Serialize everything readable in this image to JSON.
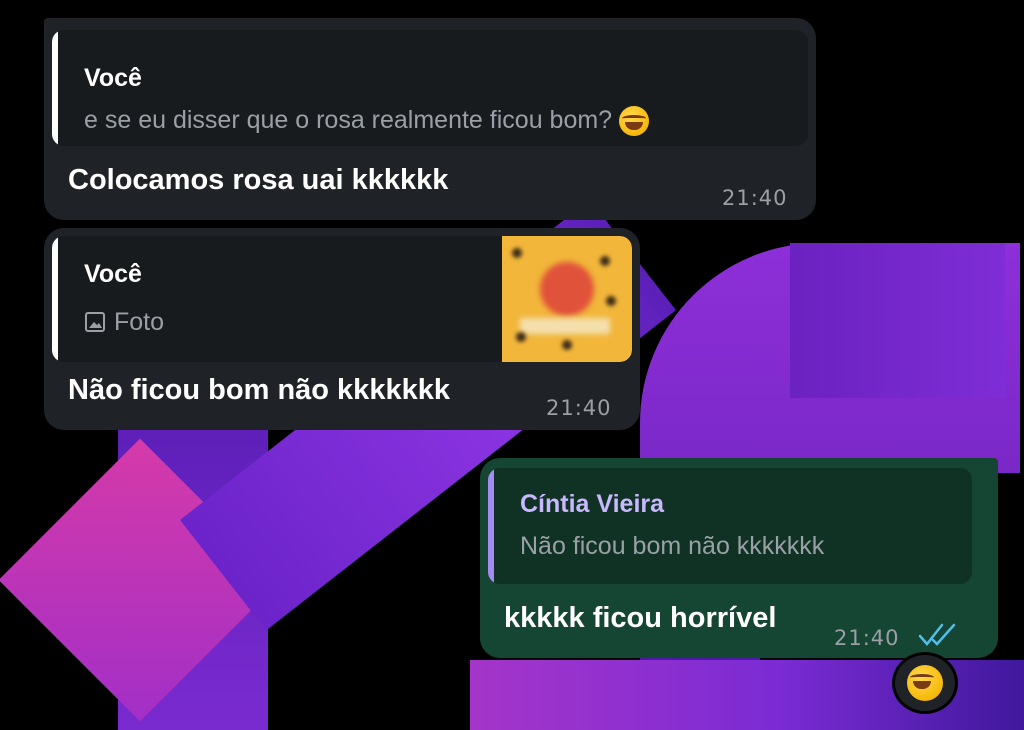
{
  "messages": [
    {
      "reply_author": "Você",
      "reply_text": "e se eu disser que o rosa realmente ficou bom?",
      "reply_emoji": "tears-of-joy-emoji",
      "text": "Colocamos rosa uai kkkkkk",
      "time": "21:40"
    },
    {
      "reply_author": "Você",
      "reply_text": "Foto",
      "reply_icon": "image-icon",
      "text": "Não ficou bom não kkkkkkk",
      "time": "21:40"
    },
    {
      "reply_author": "Cíntia Vieira",
      "reply_text": "Não ficou bom não kkkkkkk",
      "text": "kkkkk ficou horrível",
      "time": "21:40",
      "status": "double-check-read"
    }
  ],
  "reaction": "tears-of-joy-emoji",
  "colors": {
    "incoming_bubble": "#1f2327",
    "outgoing_bubble": "#154533",
    "own_quote_bar": "#ffffff",
    "other_quote_bar": "#a58af0",
    "other_author": "#c9b8ff",
    "read_check": "#53bdeb"
  }
}
